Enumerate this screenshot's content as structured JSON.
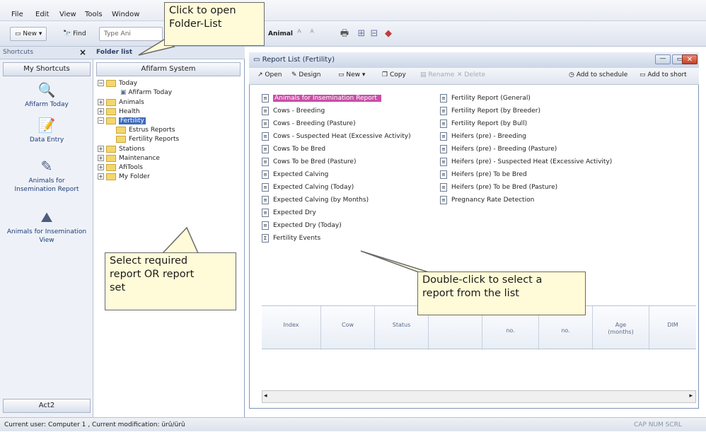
{
  "menu": [
    "File",
    "Edit",
    "View",
    "Tools",
    "Window"
  ],
  "toolbar": {
    "new_label": "New",
    "find_label": "Find",
    "search_placeholder": "Type Ani",
    "animal_label": "Animal"
  },
  "shortcuts": {
    "header": "Shortcuts",
    "close": "×",
    "my_shortcuts": "My Shortcuts",
    "items": [
      "Afifarm Today",
      "Data Entry",
      "Animals for Insemination Report",
      "Animals for Insemination View"
    ],
    "bottom_button": "Act2"
  },
  "folder_list": {
    "header": "Folder list",
    "system_button": "Afifarm System",
    "tree": [
      "Today",
      "Afifarm Today",
      "Animals",
      "Health",
      "Fertility",
      "Estrus Reports",
      "Fertility Reports",
      "Stations",
      "Maintenance",
      "AfiTools",
      "My Folder"
    ]
  },
  "report_window": {
    "title": "Report List (Fertility)",
    "toolbar": [
      "Open",
      "Design",
      "New",
      "Copy",
      "Rename",
      "Delete",
      "Add to schedule",
      "Add to short"
    ],
    "reports_left": [
      "Animals for Insemination Report",
      "Cows - Breeding",
      "Cows - Breeding (Pasture)",
      "Cows - Suspected Heat (Excessive Activity)",
      "Cows To be Bred",
      "Cows To be Bred (Pasture)",
      "Expected Calving",
      "Expected Calving (Today)",
      "Expected Calving (by Months)",
      "Expected Dry",
      "Expected Dry (Today)",
      "Fertility Events"
    ],
    "reports_right": [
      "Fertility Report (General)",
      "Fertility Report (by Breeder)",
      "Fertility Report (by Bull)",
      "Heifers (pre) - Breeding",
      "Heifers (pre) - Breeding (Pasture)",
      "Heifers (pre) - Suspected Heat (Excessive Activity)",
      "Heifers (pre) To be Bred",
      "Heifers (pre) To be Bred (Pasture)",
      "Pregnancy Rate Detection"
    ],
    "grid_columns": [
      "Index",
      "Cow",
      "Status",
      "",
      "no.",
      "no.",
      "Age (months)",
      "DIM"
    ]
  },
  "status": {
    "left": "Current user: Computer 1 , Current modification: ürû/ürû",
    "right": "CAP  NUM  SCRL"
  },
  "callouts": {
    "folder": [
      "Click to open",
      "Folder-List"
    ],
    "select": [
      "Select required",
      "report OR report",
      "set"
    ],
    "dblclick": [
      "Double-click to select a",
      "report from the list"
    ]
  }
}
